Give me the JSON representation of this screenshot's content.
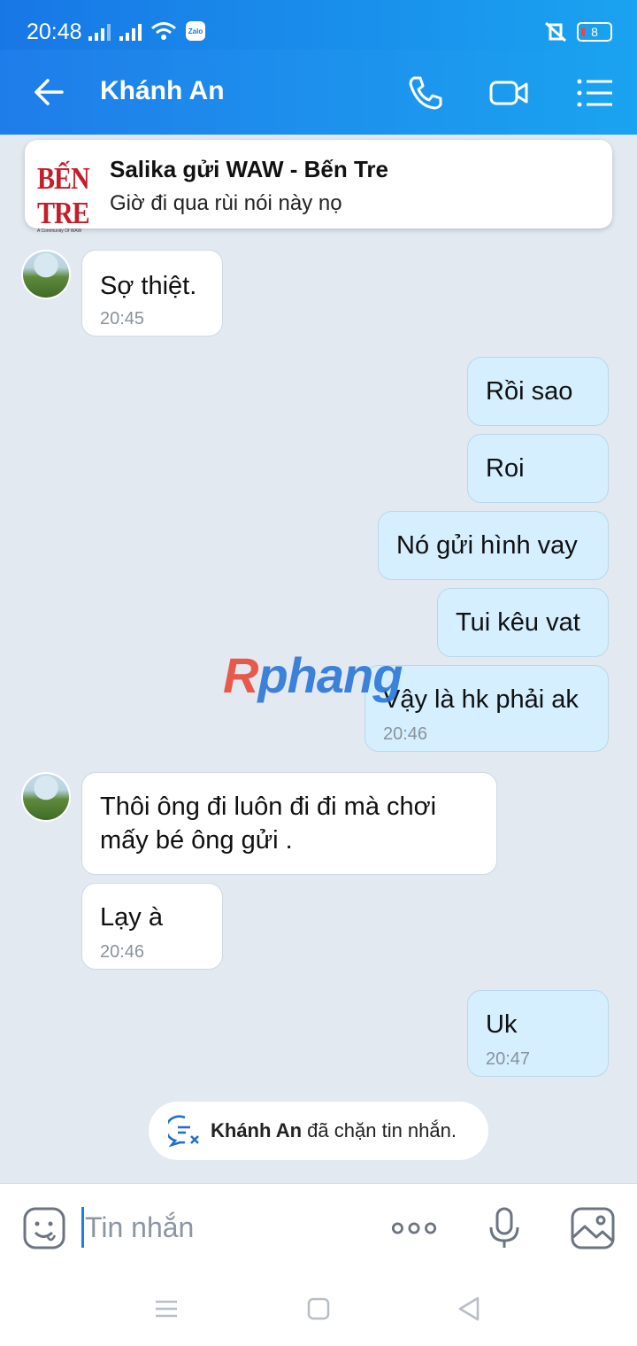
{
  "status_bar": {
    "time": "20:48",
    "zalo_badge": "Zalo",
    "battery": "8"
  },
  "header": {
    "title": "Khánh An"
  },
  "pinned": {
    "logo_text": "BẾN TRE",
    "logo_sub": "A Community Of WAW",
    "title": "Salika gửi WAW - Bến Tre",
    "text": "Giờ đi qua rùi nói này nọ"
  },
  "messages": [
    {
      "text": "Sợ thiệt.",
      "time": "20:45"
    },
    {
      "text": "Rồi sao"
    },
    {
      "text": "Roi"
    },
    {
      "text": "Nó gửi hình vay"
    },
    {
      "text": "Tui kêu vat"
    },
    {
      "text": "Vậy là hk phải ak",
      "time": "20:46"
    },
    {
      "text_line1": "Thôi ông đi luôn đi đi mà chơi",
      "text_line2": "mấy bé ông gửi ."
    },
    {
      "text": "Lạy à",
      "time": "20:46"
    },
    {
      "text": "Uk",
      "time": "20:47"
    }
  ],
  "watermark": {
    "r": "R",
    "rest": "phang"
  },
  "block_notice": {
    "name": "Khánh An",
    "text": " đã chặn tin nhắn."
  },
  "composer": {
    "placeholder": "Tin nhắn"
  }
}
